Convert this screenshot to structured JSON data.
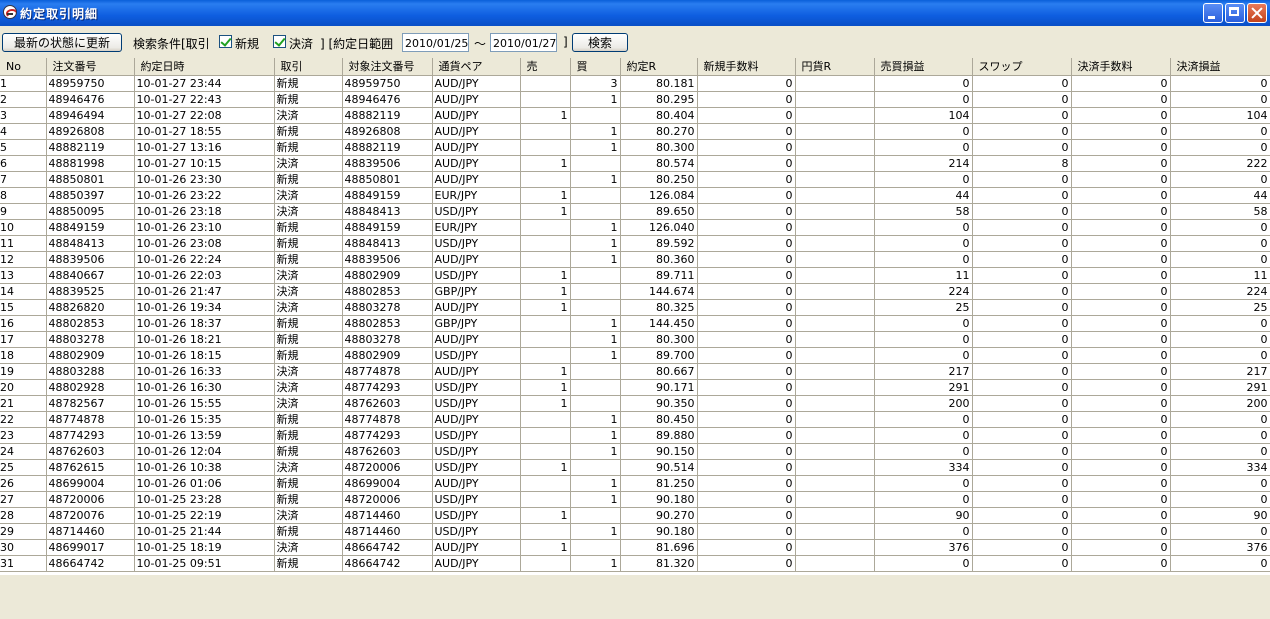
{
  "window": {
    "title": "約定取引明細"
  },
  "toolbar": {
    "refresh_label": "最新の状態に更新",
    "search_cond_label": "検索条件[取引",
    "new_label": "新規",
    "settle_label": "決済",
    "range_label": "] [約定日範囲",
    "date_from": "2010/01/25",
    "tilde": "～",
    "date_to": "2010/01/27",
    "close_bracket": "]",
    "search_label": "検索"
  },
  "table": {
    "columns": [
      "No",
      "注文番号",
      "約定日時",
      "取引",
      "対象注文番号",
      "通貨ペア",
      "売",
      "買",
      "約定R",
      "新規手数料",
      "円貨R",
      "売買損益",
      "スワップ",
      "決済手数料",
      "決済損益"
    ],
    "rows": [
      [
        "1",
        "48959750",
        "10-01-27 23:44",
        "新規",
        "48959750",
        "AUD/JPY",
        "",
        "3",
        "80.181",
        "0",
        "",
        "0",
        "0",
        "0",
        "0"
      ],
      [
        "2",
        "48946476",
        "10-01-27 22:43",
        "新規",
        "48946476",
        "AUD/JPY",
        "",
        "1",
        "80.295",
        "0",
        "",
        "0",
        "0",
        "0",
        "0"
      ],
      [
        "3",
        "48946494",
        "10-01-27 22:08",
        "決済",
        "48882119",
        "AUD/JPY",
        "1",
        "",
        "80.404",
        "0",
        "",
        "104",
        "0",
        "0",
        "104"
      ],
      [
        "4",
        "48926808",
        "10-01-27 18:55",
        "新規",
        "48926808",
        "AUD/JPY",
        "",
        "1",
        "80.270",
        "0",
        "",
        "0",
        "0",
        "0",
        "0"
      ],
      [
        "5",
        "48882119",
        "10-01-27 13:16",
        "新規",
        "48882119",
        "AUD/JPY",
        "",
        "1",
        "80.300",
        "0",
        "",
        "0",
        "0",
        "0",
        "0"
      ],
      [
        "6",
        "48881998",
        "10-01-27 10:15",
        "決済",
        "48839506",
        "AUD/JPY",
        "1",
        "",
        "80.574",
        "0",
        "",
        "214",
        "8",
        "0",
        "222"
      ],
      [
        "7",
        "48850801",
        "10-01-26 23:30",
        "新規",
        "48850801",
        "AUD/JPY",
        "",
        "1",
        "80.250",
        "0",
        "",
        "0",
        "0",
        "0",
        "0"
      ],
      [
        "8",
        "48850397",
        "10-01-26 23:22",
        "決済",
        "48849159",
        "EUR/JPY",
        "1",
        "",
        "126.084",
        "0",
        "",
        "44",
        "0",
        "0",
        "44"
      ],
      [
        "9",
        "48850095",
        "10-01-26 23:18",
        "決済",
        "48848413",
        "USD/JPY",
        "1",
        "",
        "89.650",
        "0",
        "",
        "58",
        "0",
        "0",
        "58"
      ],
      [
        "10",
        "48849159",
        "10-01-26 23:10",
        "新規",
        "48849159",
        "EUR/JPY",
        "",
        "1",
        "126.040",
        "0",
        "",
        "0",
        "0",
        "0",
        "0"
      ],
      [
        "11",
        "48848413",
        "10-01-26 23:08",
        "新規",
        "48848413",
        "USD/JPY",
        "",
        "1",
        "89.592",
        "0",
        "",
        "0",
        "0",
        "0",
        "0"
      ],
      [
        "12",
        "48839506",
        "10-01-26 22:24",
        "新規",
        "48839506",
        "AUD/JPY",
        "",
        "1",
        "80.360",
        "0",
        "",
        "0",
        "0",
        "0",
        "0"
      ],
      [
        "13",
        "48840667",
        "10-01-26 22:03",
        "決済",
        "48802909",
        "USD/JPY",
        "1",
        "",
        "89.711",
        "0",
        "",
        "11",
        "0",
        "0",
        "11"
      ],
      [
        "14",
        "48839525",
        "10-01-26 21:47",
        "決済",
        "48802853",
        "GBP/JPY",
        "1",
        "",
        "144.674",
        "0",
        "",
        "224",
        "0",
        "0",
        "224"
      ],
      [
        "15",
        "48826820",
        "10-01-26 19:34",
        "決済",
        "48803278",
        "AUD/JPY",
        "1",
        "",
        "80.325",
        "0",
        "",
        "25",
        "0",
        "0",
        "25"
      ],
      [
        "16",
        "48802853",
        "10-01-26 18:37",
        "新規",
        "48802853",
        "GBP/JPY",
        "",
        "1",
        "144.450",
        "0",
        "",
        "0",
        "0",
        "0",
        "0"
      ],
      [
        "17",
        "48803278",
        "10-01-26 18:21",
        "新規",
        "48803278",
        "AUD/JPY",
        "",
        "1",
        "80.300",
        "0",
        "",
        "0",
        "0",
        "0",
        "0"
      ],
      [
        "18",
        "48802909",
        "10-01-26 18:15",
        "新規",
        "48802909",
        "USD/JPY",
        "",
        "1",
        "89.700",
        "0",
        "",
        "0",
        "0",
        "0",
        "0"
      ],
      [
        "19",
        "48803288",
        "10-01-26 16:33",
        "決済",
        "48774878",
        "AUD/JPY",
        "1",
        "",
        "80.667",
        "0",
        "",
        "217",
        "0",
        "0",
        "217"
      ],
      [
        "20",
        "48802928",
        "10-01-26 16:30",
        "決済",
        "48774293",
        "USD/JPY",
        "1",
        "",
        "90.171",
        "0",
        "",
        "291",
        "0",
        "0",
        "291"
      ],
      [
        "21",
        "48782567",
        "10-01-26 15:55",
        "決済",
        "48762603",
        "USD/JPY",
        "1",
        "",
        "90.350",
        "0",
        "",
        "200",
        "0",
        "0",
        "200"
      ],
      [
        "22",
        "48774878",
        "10-01-26 15:35",
        "新規",
        "48774878",
        "AUD/JPY",
        "",
        "1",
        "80.450",
        "0",
        "",
        "0",
        "0",
        "0",
        "0"
      ],
      [
        "23",
        "48774293",
        "10-01-26 13:59",
        "新規",
        "48774293",
        "USD/JPY",
        "",
        "1",
        "89.880",
        "0",
        "",
        "0",
        "0",
        "0",
        "0"
      ],
      [
        "24",
        "48762603",
        "10-01-26 12:04",
        "新規",
        "48762603",
        "USD/JPY",
        "",
        "1",
        "90.150",
        "0",
        "",
        "0",
        "0",
        "0",
        "0"
      ],
      [
        "25",
        "48762615",
        "10-01-26 10:38",
        "決済",
        "48720006",
        "USD/JPY",
        "1",
        "",
        "90.514",
        "0",
        "",
        "334",
        "0",
        "0",
        "334"
      ],
      [
        "26",
        "48699004",
        "10-01-26 01:06",
        "新規",
        "48699004",
        "AUD/JPY",
        "",
        "1",
        "81.250",
        "0",
        "",
        "0",
        "0",
        "0",
        "0"
      ],
      [
        "27",
        "48720006",
        "10-01-25 23:28",
        "新規",
        "48720006",
        "USD/JPY",
        "",
        "1",
        "90.180",
        "0",
        "",
        "0",
        "0",
        "0",
        "0"
      ],
      [
        "28",
        "48720076",
        "10-01-25 22:19",
        "決済",
        "48714460",
        "USD/JPY",
        "1",
        "",
        "90.270",
        "0",
        "",
        "90",
        "0",
        "0",
        "90"
      ],
      [
        "29",
        "48714460",
        "10-01-25 21:44",
        "新規",
        "48714460",
        "USD/JPY",
        "",
        "1",
        "90.180",
        "0",
        "",
        "0",
        "0",
        "0",
        "0"
      ],
      [
        "30",
        "48699017",
        "10-01-25 18:19",
        "決済",
        "48664742",
        "AUD/JPY",
        "1",
        "",
        "81.696",
        "0",
        "",
        "376",
        "0",
        "0",
        "376"
      ],
      [
        "31",
        "48664742",
        "10-01-25 09:51",
        "新規",
        "48664742",
        "AUD/JPY",
        "",
        "1",
        "81.320",
        "0",
        "",
        "0",
        "0",
        "0",
        "0"
      ]
    ]
  },
  "icons": {
    "app": "app-icon",
    "minimize": "minimize-icon",
    "maximize": "maximize-icon",
    "close": "close-icon"
  },
  "colors": {
    "titlebar": "#0a5fd9",
    "close_button": "#c3421b",
    "checkbox_check": "#21a121"
  }
}
